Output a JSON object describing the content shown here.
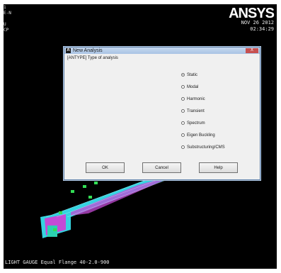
{
  "viewport": {
    "corner_labels": [
      "1",
      "E-N",
      "U",
      "CP"
    ],
    "logo": "ANSYS",
    "date": "NOV 26 2012",
    "time": "02:34:29",
    "caption": "LIGHT GAUGE Equal Flange 40-2.0-900"
  },
  "dialog": {
    "icon": "A",
    "title": "New Analysis",
    "close_label": "X",
    "prompt": "[ANTYPE]  Type of analysis",
    "options": [
      {
        "label": "Static",
        "selected": true
      },
      {
        "label": "Modal",
        "selected": false
      },
      {
        "label": "Harmonic",
        "selected": false
      },
      {
        "label": "Transient",
        "selected": false
      },
      {
        "label": "Spectrum",
        "selected": false
      },
      {
        "label": "Eigen Buckling",
        "selected": false
      },
      {
        "label": "Substructuring/CMS",
        "selected": false
      }
    ],
    "buttons": {
      "ok": "OK",
      "cancel": "Cancel",
      "help": "Help"
    }
  },
  "colors": {
    "background": "#000000",
    "model_mesh": "#35d4e0",
    "model_highlight": "#c44bd6",
    "constraints": "#33dd55"
  }
}
